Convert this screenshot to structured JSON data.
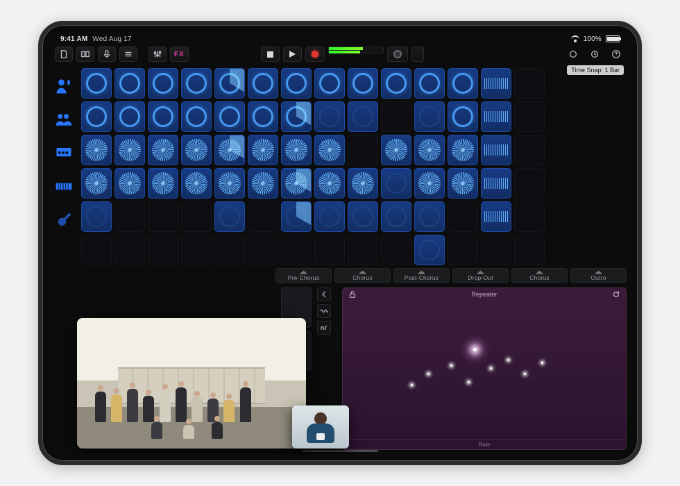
{
  "status": {
    "time": "9:41 AM",
    "date": "Wed Aug 17",
    "battery": "100%"
  },
  "toolbar": {
    "fx": "FX",
    "project": "project",
    "display_mode": "display",
    "mic": "mic",
    "browser": "browser",
    "mixer": "mixer"
  },
  "time_snap": "Time Snap: 1 Bar",
  "sidebar": {
    "items": [
      {
        "name": "artist-voice",
        "label": "Artist"
      },
      {
        "name": "group-vocals",
        "label": "Group"
      },
      {
        "name": "drum-machine",
        "label": "Drums"
      },
      {
        "name": "keyboard",
        "label": "Keys"
      },
      {
        "name": "guitar",
        "label": "Guitar"
      }
    ]
  },
  "sections": [
    "Pre-Chorus",
    "Chorus",
    "Post-Chorus",
    "Drop-Out",
    "Chorus",
    "Outro"
  ],
  "repeater": {
    "title": "Repeater",
    "rate_label": "Rate"
  },
  "pip": {
    "main_alt": "SEVENTEEN group photo",
    "small_alt": "FaceTime caller"
  },
  "grid": {
    "rows": 6,
    "cols": 14,
    "cells": [
      [
        "f",
        "f",
        "f",
        "f",
        "fp",
        "f",
        "f",
        "f",
        "f",
        "f",
        "f",
        "f",
        "fw",
        "e"
      ],
      [
        "f",
        "f",
        "f",
        "f",
        "f",
        "f",
        "fp",
        "fd",
        "fd",
        "e",
        "fd",
        "f",
        "fw",
        "e"
      ],
      [
        "fs",
        "fs",
        "fs",
        "fs",
        "fsp",
        "fs",
        "fs",
        "fs",
        "e",
        "fs",
        "fs",
        "fs",
        "fw",
        "e"
      ],
      [
        "fs",
        "fs",
        "fs",
        "fs",
        "fs",
        "fs",
        "fsp",
        "fs",
        "fs",
        "fd",
        "fs",
        "fs",
        "fw",
        "e"
      ],
      [
        "fd",
        "e",
        "e",
        "e",
        "fd",
        "e",
        "fdp",
        "fd",
        "fd",
        "fd",
        "fd",
        "e",
        "fw",
        "e"
      ],
      [
        "e",
        "e",
        "e",
        "e",
        "e",
        "e",
        "e",
        "e",
        "e",
        "e",
        "fd",
        "e",
        "e",
        "e"
      ]
    ]
  },
  "colors": {
    "accent_blue": "#2676ff",
    "loop_blue": "#4da6ff",
    "record_red": "#e2362e",
    "fx_pink": "#e43ea9",
    "repeater_purple": "#3b1d3a"
  }
}
